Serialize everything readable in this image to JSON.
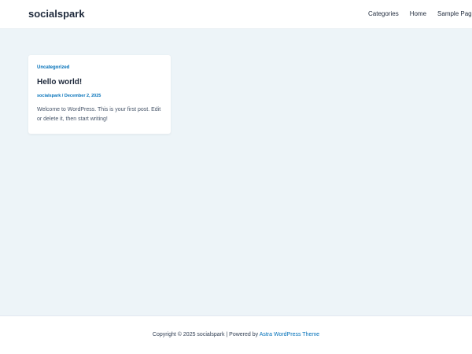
{
  "header": {
    "site_title": "socialspark",
    "nav": {
      "categories": "Categories",
      "home": "Home",
      "sample_page": "Sample Page"
    }
  },
  "post": {
    "category": "Uncategorized",
    "title": "Hello world!",
    "author": "socialspark",
    "separator": " / ",
    "date": "December 2, 2025",
    "excerpt": "Welcome to WordPress. This is your first post. Edit or delete it, then start writing!"
  },
  "footer": {
    "copyright": "Copyright © 2025 socialspark | Powered by ",
    "theme_link": "Astra WordPress Theme"
  },
  "colors": {
    "accent": "#0170b9",
    "content_background": "#edf4f8",
    "heading": "#1e293b"
  }
}
